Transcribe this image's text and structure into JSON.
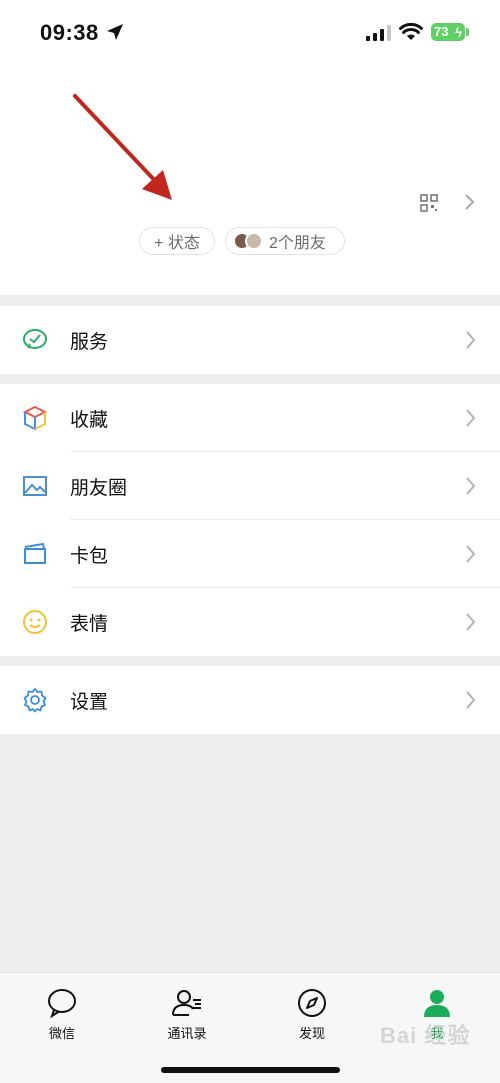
{
  "status_bar": {
    "time": "09:38",
    "battery": "73"
  },
  "profile": {
    "status_button": "+ 状态",
    "friends_label": "2个朋友"
  },
  "menu": {
    "service": "服务",
    "favorites": "收藏",
    "moments": "朋友圈",
    "cards": "卡包",
    "stickers": "表情",
    "settings": "设置"
  },
  "tabs": [
    {
      "label": "微信",
      "icon": "chat-icon"
    },
    {
      "label": "通讯录",
      "icon": "contacts-icon"
    },
    {
      "label": "发现",
      "icon": "compass-icon"
    },
    {
      "label": "我",
      "icon": "person-icon",
      "active": true
    }
  ],
  "watermark": "Bai 经验",
  "colors": {
    "accent": "#1aad5b",
    "annotation_arrow": "#c0281e"
  }
}
